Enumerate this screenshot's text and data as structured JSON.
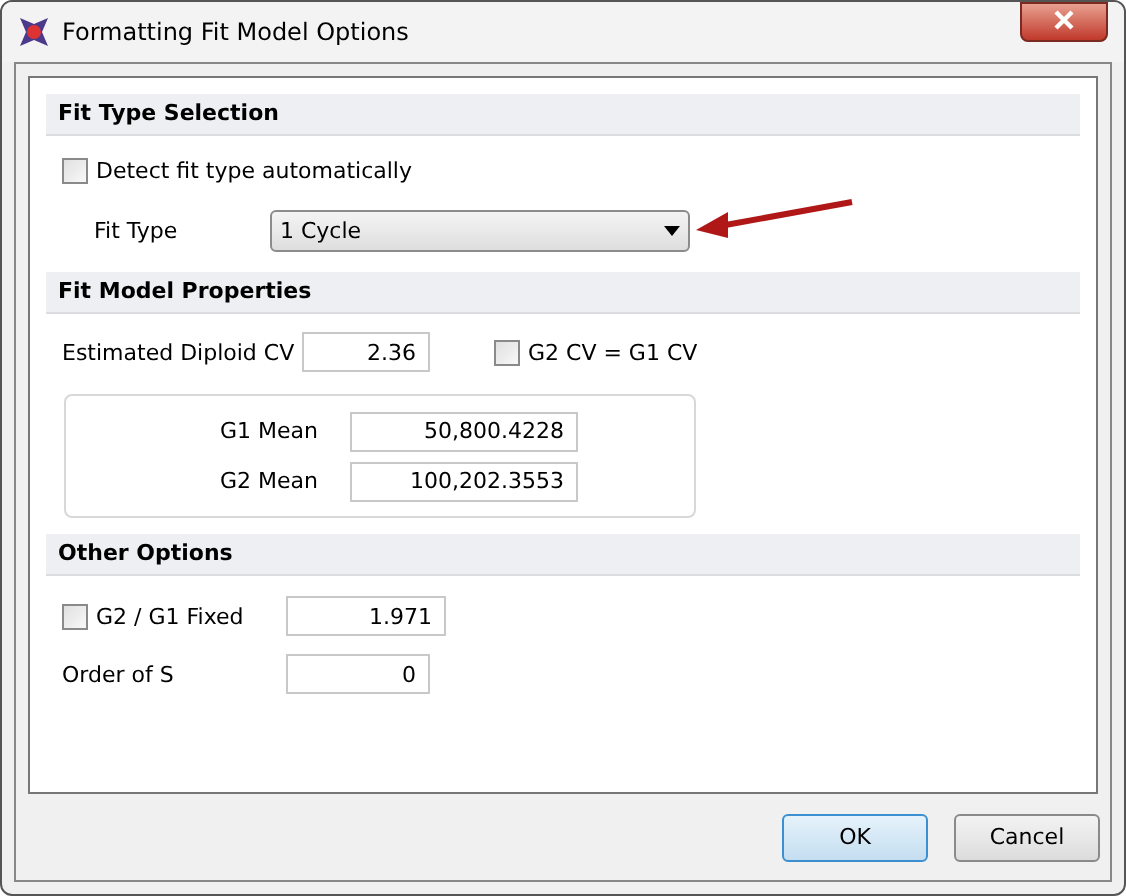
{
  "window": {
    "title": "Formatting Fit Model Options"
  },
  "fit_type_selection": {
    "heading": "Fit Type Selection",
    "detect_auto": {
      "label": "Detect fit type automatically",
      "checked": false
    },
    "fit_type": {
      "label": "Fit Type",
      "value": "1 Cycle"
    }
  },
  "fit_model_properties": {
    "heading": "Fit Model Properties",
    "diploid_cv": {
      "label": "Estimated Diploid CV",
      "value": "2.36"
    },
    "g2_cv_equal": {
      "label": "G2 CV = G1 CV",
      "checked": false
    },
    "means": [
      {
        "label": "G1 Mean",
        "value": "50,800.4228"
      },
      {
        "label": "G2 Mean",
        "value": "100,202.3553"
      }
    ]
  },
  "other_options": {
    "heading": "Other Options",
    "g2_g1_fixed": {
      "label": "G2 / G1 Fixed",
      "checked": false,
      "value": "1.971"
    },
    "order_of_s": {
      "label": "Order of S",
      "value": "0"
    }
  },
  "buttons": [
    {
      "label": "OK",
      "default": true
    },
    {
      "label": "Cancel",
      "default": false
    }
  ]
}
